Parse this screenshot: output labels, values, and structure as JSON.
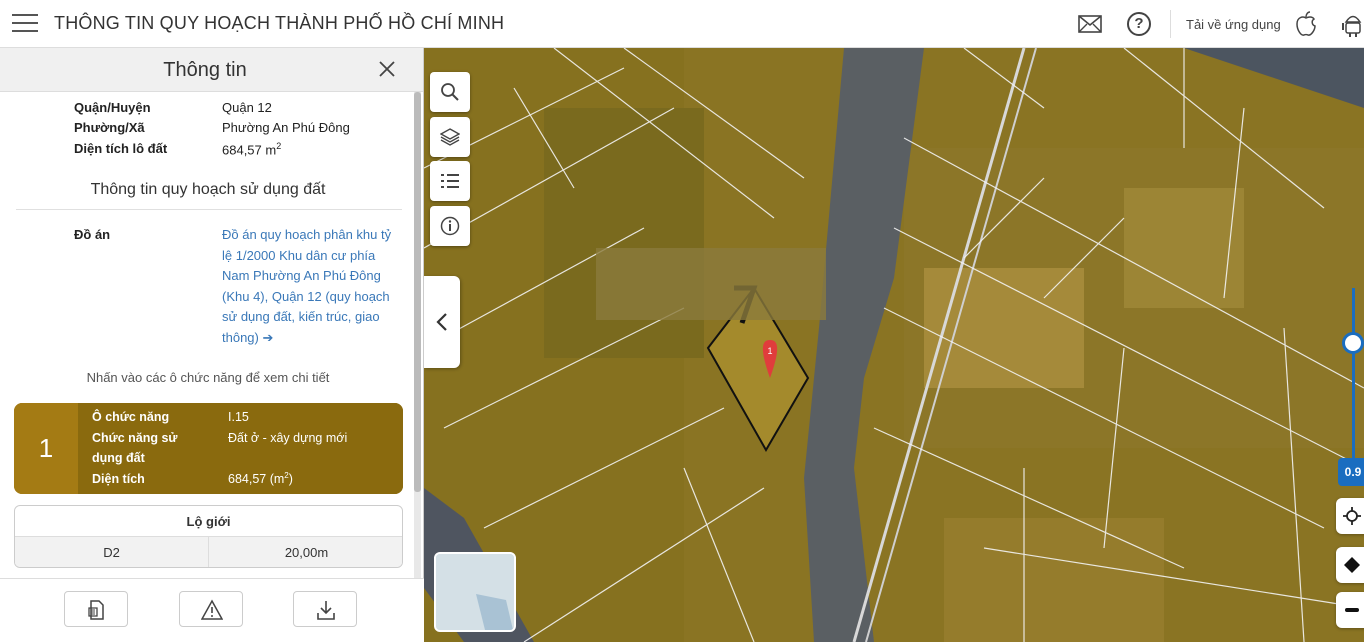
{
  "header": {
    "title": "THÔNG TIN QUY HOẠCH THÀNH PHỐ HỒ CHÍ MINH",
    "download_label": "Tải về ứng dụng",
    "help_label": "?"
  },
  "panel": {
    "title": "Thông tin",
    "details": [
      {
        "label": "Quận/Huyện",
        "value": "Quận 12"
      },
      {
        "label": "Phường/Xã",
        "value": "Phường An Phú Đông"
      },
      {
        "label": "Diện tích lô đất",
        "value": "684,57 m",
        "sup": "2"
      }
    ],
    "section_title": "Thông tin quy hoạch sử dụng đất",
    "doan_label": "Đồ án",
    "doan_value": "Đồ án quy hoạch phân khu tỷ lệ 1/2000 Khu dân cư phía Nam Phường An Phú Đông (Khu 4), Quận 12 (quy hoạch sử dụng đất, kiến trúc, giao thông)",
    "doan_arrow": "➔",
    "hint": "Nhấn vào các ô chức năng để xem chi tiết",
    "function_cell": {
      "number": "1",
      "rows": [
        {
          "label": "Ô chức năng",
          "value": "I.15"
        },
        {
          "label": "Chức năng sử",
          "label2": "dụng đất",
          "value": "Đất ở - xây dựng mới"
        },
        {
          "label": "Diện tích",
          "value": "684,57 (m",
          "sup": "2",
          "tail": ")"
        }
      ],
      "color": "#a47b14"
    },
    "lo_gioi": {
      "title": "Lộ giới",
      "road": "D2",
      "width": "20,00m"
    }
  },
  "map": {
    "marker_label": "1",
    "opacity_value": "0.9",
    "overlay_color": "#b8921c"
  }
}
